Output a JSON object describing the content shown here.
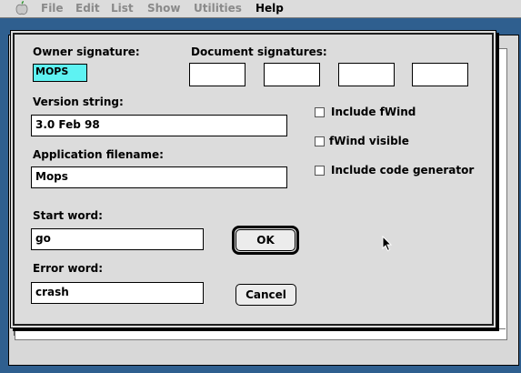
{
  "menubar": {
    "apple_icon": "apple-icon",
    "items": [
      {
        "label": "File",
        "enabled": false
      },
      {
        "label": "Edit",
        "enabled": false
      },
      {
        "label": "List",
        "enabled": false
      },
      {
        "label": "Show",
        "enabled": false
      },
      {
        "label": "Utilities",
        "enabled": false
      },
      {
        "label": "Help",
        "enabled": true
      }
    ]
  },
  "dialog": {
    "owner_signature": {
      "label": "Owner signature:",
      "value": "MOPS"
    },
    "document_signatures": {
      "label": "Document signatures:",
      "values": [
        "",
        "",
        "",
        ""
      ]
    },
    "version_string": {
      "label": "Version string:",
      "value": "3.0 Feb 98"
    },
    "application_filename": {
      "label": "Application filename:",
      "value": "Mops"
    },
    "start_word": {
      "label": "Start word:",
      "value": "go"
    },
    "error_word": {
      "label": "Error word:",
      "value": "crash"
    },
    "checkboxes": [
      {
        "label": "Include fWind",
        "checked": false
      },
      {
        "label": "fWind visible",
        "checked": false
      },
      {
        "label": "Include code generator",
        "checked": false
      }
    ],
    "ok_button": "OK",
    "cancel_button": "Cancel"
  },
  "colors": {
    "desktop": "#2f5f8f",
    "owner_field_highlight": "#5ef2f2",
    "dialog_background": "#dcdcdc"
  },
  "cursor_icon": "arrow-pointer-icon"
}
